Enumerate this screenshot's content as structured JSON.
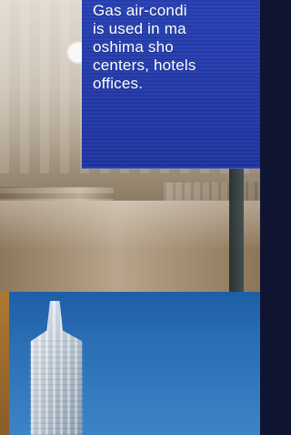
{
  "caption": {
    "text": "Gas air-condi\nis used in ma\noshima  sho\ncenters, hotels\noffices."
  },
  "colors": {
    "panel_blue": "#2740b3",
    "sky_blue": "#2a6eb4"
  }
}
